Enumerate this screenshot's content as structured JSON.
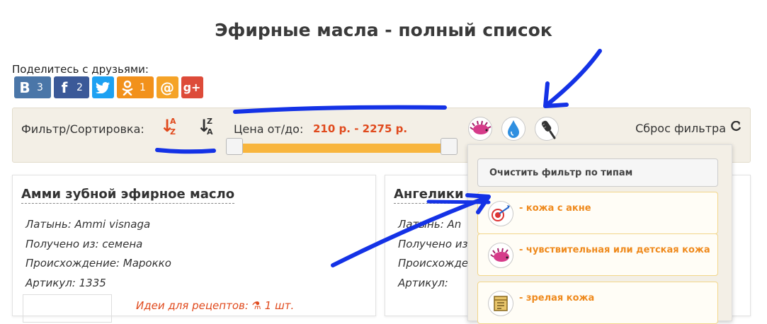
{
  "page_title": "Эфирные масла - полный список",
  "share": {
    "label": "Поделитесь с друзьями:",
    "buttons": [
      {
        "symbol": "В",
        "count": "3"
      },
      {
        "symbol": "f",
        "count": "2"
      },
      {
        "symbol": "t",
        "count": ""
      },
      {
        "symbol": "ок",
        "count": "1"
      },
      {
        "symbol": "@",
        "count": ""
      },
      {
        "symbol": "g+",
        "count": ""
      }
    ]
  },
  "filter": {
    "label": "Фильтр/Сортировка:",
    "sort_az": {
      "l1": "A",
      "l2": "Z"
    },
    "sort_za": {
      "l1": "Z",
      "l2": "A"
    },
    "price_label": "Цена от/до:",
    "price_range": "210 р. - 2275 р.",
    "reset_label": "Сброс фильтра"
  },
  "cards": [
    {
      "title": "Амми зубной эфирное масло",
      "latin": "Латынь: Ammi visnaga",
      "source": "Получено из: семена",
      "origin": "Происхождение: Марокко",
      "article": "Артикул: 1335",
      "ideas": "Идеи для рецептов: ⚗ 1 шт."
    },
    {
      "title": "Ангелики",
      "latin": "Латынь: An",
      "source": "Получено из:",
      "origin": "Происхождение:",
      "article": "Артикул:"
    }
  ],
  "dropdown": {
    "clear": "Очистить фильтр по типам",
    "items": [
      {
        "label": "- кожа с акне"
      },
      {
        "label": "- чувствительная или детская кожа"
      },
      {
        "label": "- зрелая кожа"
      }
    ]
  },
  "colors": {
    "accent_orange": "#e04a1d",
    "slider": "#f8b53d",
    "annotation": "#1432e6"
  }
}
